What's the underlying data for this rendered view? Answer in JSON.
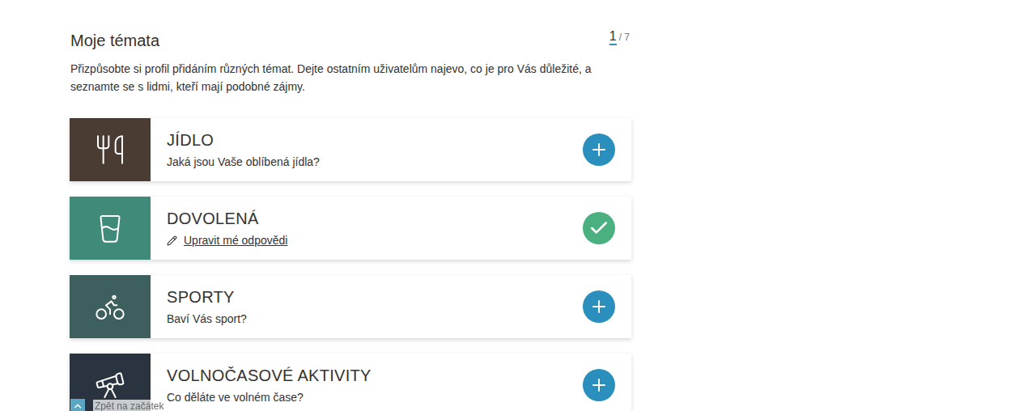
{
  "header": {
    "title": "Moje témata",
    "page": "1",
    "total": "/ 7"
  },
  "description": "Přizpůsobte si profil přidáním různých témat. Dejte ostatním uživatelům najevo, co je pro Vás důležité, a seznamte se s lidmi, kteří mají podobné zájmy.",
  "topics": [
    {
      "title": "JÍDLO",
      "subtitle": "Jaká jsou Vaše oblíbená jídla?",
      "completed": false,
      "color": "#4a3b33"
    },
    {
      "title": "DOVOLENÁ",
      "subtitle": "Upravit mé odpovědi",
      "completed": true,
      "color": "#3f8a78"
    },
    {
      "title": "SPORTY",
      "subtitle": "Baví Vás sport?",
      "completed": false,
      "color": "#3d5f5e"
    },
    {
      "title": "VOLNOČASOVÉ AKTIVITY",
      "subtitle": "Co děláte ve volném čase?",
      "completed": false,
      "color": "#2a3440"
    }
  ],
  "back_to_top": {
    "label": "Zpět na začátek"
  }
}
